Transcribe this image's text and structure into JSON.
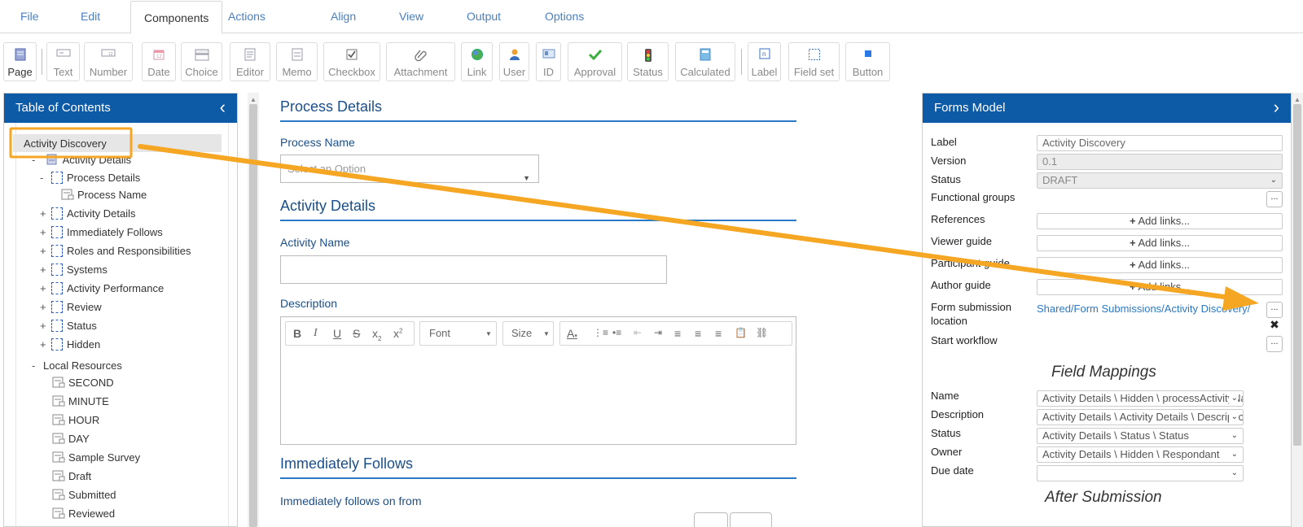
{
  "menu": {
    "items": [
      "File",
      "Edit",
      "Components",
      "Actions",
      "Align",
      "View",
      "Output",
      "Options"
    ],
    "active": "Components"
  },
  "toolbar": {
    "page": "Page",
    "text": "Text",
    "number": "Number",
    "date": "Date",
    "choice": "Choice",
    "editor": "Editor",
    "memo": "Memo",
    "checkbox": "Checkbox",
    "attachment": "Attachment",
    "link": "Link",
    "user": "User",
    "id": "ID",
    "approval": "Approval",
    "status": "Status",
    "calculated": "Calculated",
    "label": "Label",
    "field_set": "Field set",
    "button": "Button"
  },
  "toc": {
    "title": "Table of Contents",
    "root": "Activity Discovery",
    "nodes": {
      "activity_details_page": "Activity Details",
      "process_details": "Process Details",
      "process_name": "Process Name",
      "activity_details": "Activity Details",
      "immediately_follows": "Immediately Follows",
      "roles": "Roles and Responsibilities",
      "systems": "Systems",
      "activity_performance": "Activity Performance",
      "review": "Review",
      "status": "Status",
      "hidden": "Hidden",
      "local_resources": "Local Resources",
      "second": "SECOND",
      "minute": "MINUTE",
      "hour": "HOUR",
      "day": "DAY",
      "sample_survey": "Sample Survey",
      "draft": "Draft",
      "submitted": "Submitted",
      "reviewed": "Reviewed"
    },
    "toggle_open": "-",
    "toggle_closed": "+"
  },
  "canvas": {
    "process_details_title": "Process Details",
    "process_name_label": "Process Name",
    "process_name_placeholder": "Select an Option",
    "activity_details_title": "Activity Details",
    "activity_name_label": "Activity Name",
    "description_label": "Description",
    "editor_font": "Font",
    "editor_size": "Size",
    "immediately_follows_title": "Immediately Follows",
    "immediately_follows_label": "Immediately follows on from"
  },
  "forms_model": {
    "title": "Forms Model",
    "label_label": "Label",
    "label_value": "Activity Discovery",
    "version_label": "Version",
    "version_value": "0.1",
    "status_label": "Status",
    "status_value": "DRAFT",
    "functional_groups_label": "Functional groups",
    "references_label": "References",
    "viewer_guide_label": "Viewer guide",
    "participant_guide_label": "Participant guide",
    "author_guide_label": "Author guide",
    "add_links": "Add links...",
    "plus": "+",
    "dots": "...",
    "form_submission_label_1": "Form submission",
    "form_submission_label_2": "location",
    "form_submission_value": "Shared/Form Submissions/Activity Discovery/",
    "start_workflow_label": "Start workflow",
    "field_mappings_title": "Field Mappings",
    "map_name_label": "Name",
    "map_name_value": "Activity Details \\ Hidden \\ processActivityName",
    "map_description_label": "Description",
    "map_description_value": "Activity Details \\ Activity Details \\ Description",
    "map_status_label": "Status",
    "map_status_value": "Activity Details \\ Status \\ Status",
    "map_owner_label": "Owner",
    "map_owner_value": "Activity Details \\ Hidden \\ Respondant",
    "map_due_label": "Due date",
    "map_due_value": "",
    "after_submission_title": "After Submission"
  },
  "colors": {
    "panel_header": "#0d5aa7",
    "accent": "#2a79c6",
    "annotation": "#f5a623"
  }
}
